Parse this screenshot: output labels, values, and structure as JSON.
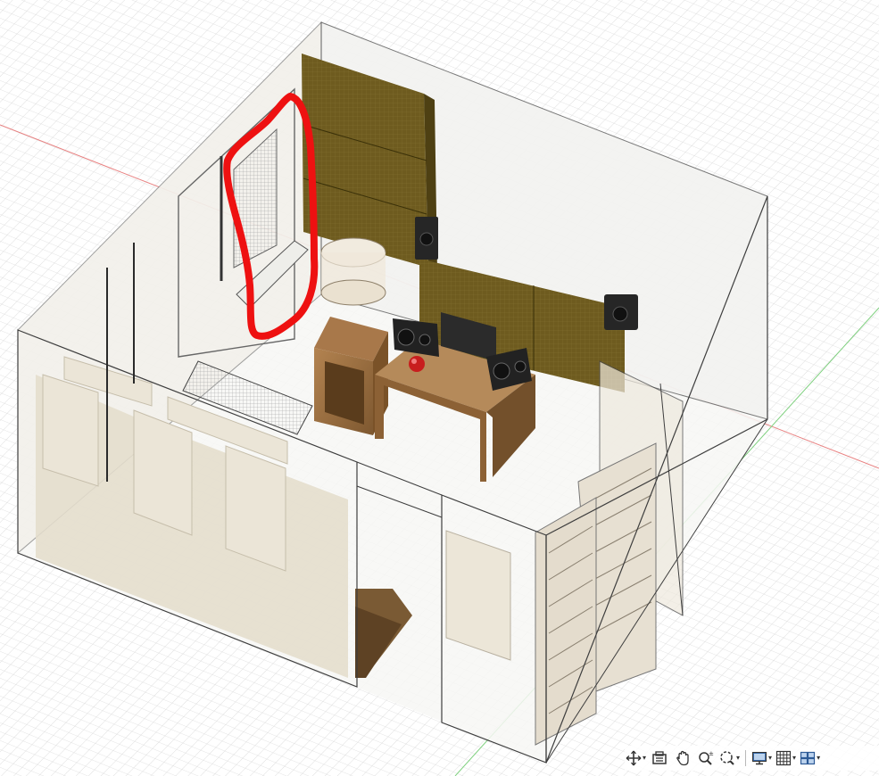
{
  "app": {
    "viewport": "3d-canvas",
    "colors": {
      "grid_line": "#cfcfcf",
      "x_axis": "#e06060",
      "y_axis": "#5cc35c",
      "wall_fill": "#e8e2d4",
      "wall_edge": "#3a3a3a",
      "acoustic_panel": "#6b5a1c",
      "wood": "#9c7040",
      "speaker": "#2a2a2a",
      "annotation": "#ee1111"
    }
  },
  "scene": {
    "objects": [
      "back-wall-acoustic-panels",
      "left-wall-window",
      "studio-monitor-left",
      "studio-monitor-right",
      "wall-speaker-left",
      "wall-speaker-right",
      "computer-monitor",
      "desk",
      "wooden-cabinet",
      "cylinder-object",
      "red-sphere",
      "bass-trap-slats",
      "armchair",
      "sofa-panels",
      "doorway"
    ],
    "annotation": "red-freehand-outline"
  },
  "toolbar": {
    "items": [
      {
        "name": "orbit-icon",
        "has_dropdown": true
      },
      {
        "name": "look-at-icon",
        "has_dropdown": false
      },
      {
        "name": "pan-icon",
        "has_dropdown": false
      },
      {
        "name": "zoom-icon",
        "has_dropdown": false
      },
      {
        "name": "fit-zoom-icon",
        "has_dropdown": true
      },
      {
        "name": "display-settings-icon",
        "has_dropdown": true
      },
      {
        "name": "grid-icon",
        "has_dropdown": true
      },
      {
        "name": "viewports-icon",
        "has_dropdown": true
      }
    ]
  }
}
